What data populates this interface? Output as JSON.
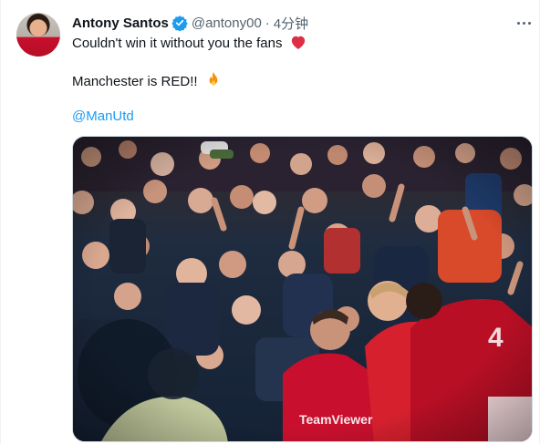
{
  "tweet": {
    "author_name": "Antony Santos",
    "handle": "@antony00",
    "separator": "·",
    "time": "4分钟",
    "line1": "Couldn't win it without you the fans",
    "line2": "Manchester is RED!!",
    "line3": "@ManUtd"
  },
  "icons": {
    "verified": "verified-badge-icon",
    "heart": "red-heart-emoji",
    "fire": "fire-emoji",
    "more": "more-options-icon"
  },
  "colors": {
    "link": "#1d9bf0",
    "verified": "#1d9bf0",
    "muted": "#536471",
    "kit_red": "#c8102e"
  }
}
